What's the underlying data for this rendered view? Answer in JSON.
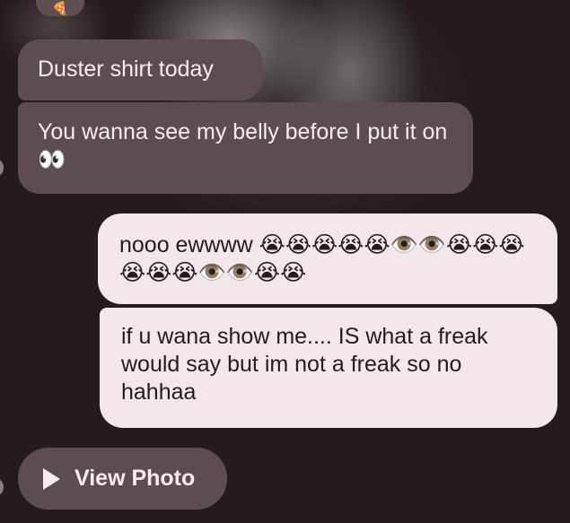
{
  "conversation": {
    "reaction_glyph": "🍕",
    "messages": [
      {
        "direction": "incoming",
        "text": "Duster shirt today"
      },
      {
        "direction": "incoming",
        "text": "You wanna see my belly before I put it on👀"
      },
      {
        "direction": "outgoing",
        "text": "nooo ewwww 😭😭😭😭😭👁️👁️😭😭😭😭😭😭👁️👁️😭😭"
      },
      {
        "direction": "outgoing",
        "text": "if u wana show me.... IS what a freak would say but im not a freak so no hahhaa"
      }
    ],
    "view_photo_label": "View Photo"
  },
  "icons": {
    "play": "play-icon",
    "avatar": "avatar-stub"
  },
  "colors": {
    "background": "#241c1e",
    "incoming_bubble": "#5d4d51",
    "outgoing_bubble": "#f3e7ea",
    "incoming_text": "#f4eef0",
    "outgoing_text": "#231c1e"
  }
}
